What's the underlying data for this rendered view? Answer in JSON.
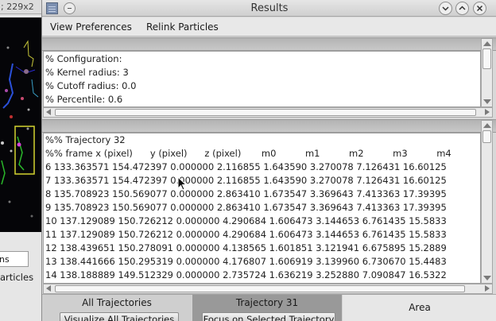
{
  "background_window": {
    "title_fragment": "; 229x2",
    "field_fragment": "ns",
    "checkbox_fragment": "articles"
  },
  "window": {
    "title": "Results"
  },
  "menu": {
    "view_preferences": "View Preferences",
    "relink_particles": "Relink Particles"
  },
  "config_lines": [
    "% Configuration:",
    "% Kernel radius: 3",
    "% Cutoff radius: 0.0",
    "% Percentile: 0.6"
  ],
  "trajectory": {
    "header": "%% Trajectory 32",
    "columns": "%% frame x (pixel)      y (pixel)      z (pixel)       m0          m1          m2          m3          m4",
    "rows": [
      "6 133.363571 154.472397 0.000000 2.116855 1.643590 3.270078 7.126431 16.60125",
      "7 133.363571 154.472397 0.000000 2.116855 1.643590 3.270078 7.126431 16.60125",
      "8 135.708923 150.569077 0.000000 2.863410 1.673547 3.369643 7.413363 17.39395",
      "9 135.708923 150.569077 0.000000 2.863410 1.673547 3.369643 7.413363 17.39395",
      "10 137.129089 150.726212 0.000000 4.290684 1.606473 3.144653 6.761435 15.5833",
      "11 137.129089 150.726212 0.000000 4.290684 1.606473 3.144653 6.761435 15.5833",
      "12 138.439651 150.278091 0.000000 4.138565 1.601851 3.121941 6.675895 15.2889",
      "13 138.441666 150.295319 0.000000 4.176807 1.606919 3.139960 6.730670 15.4483",
      "14 138.188889 149.512329 0.000000 2.735724 1.636219 3.252880 7.090847 16.5322"
    ]
  },
  "bottom": {
    "all_trajectories": "All Trajectories",
    "visualize_all": "Visualize All Trajectories",
    "trajectory_n": "Trajectory 31",
    "focus_selected": "Focus on Selected Trajectory",
    "area": "Area"
  },
  "icons": {
    "app": "app-icon",
    "menu": "window-menu-icon",
    "minimize": "minimize-icon",
    "maximize": "maximize-icon",
    "close": "close-icon",
    "cursor": "mouse-pointer-icon"
  },
  "colors": {
    "trajectory_tab_active": "#999999",
    "text_bg": "#ffffff",
    "image_bg": "#050508"
  }
}
